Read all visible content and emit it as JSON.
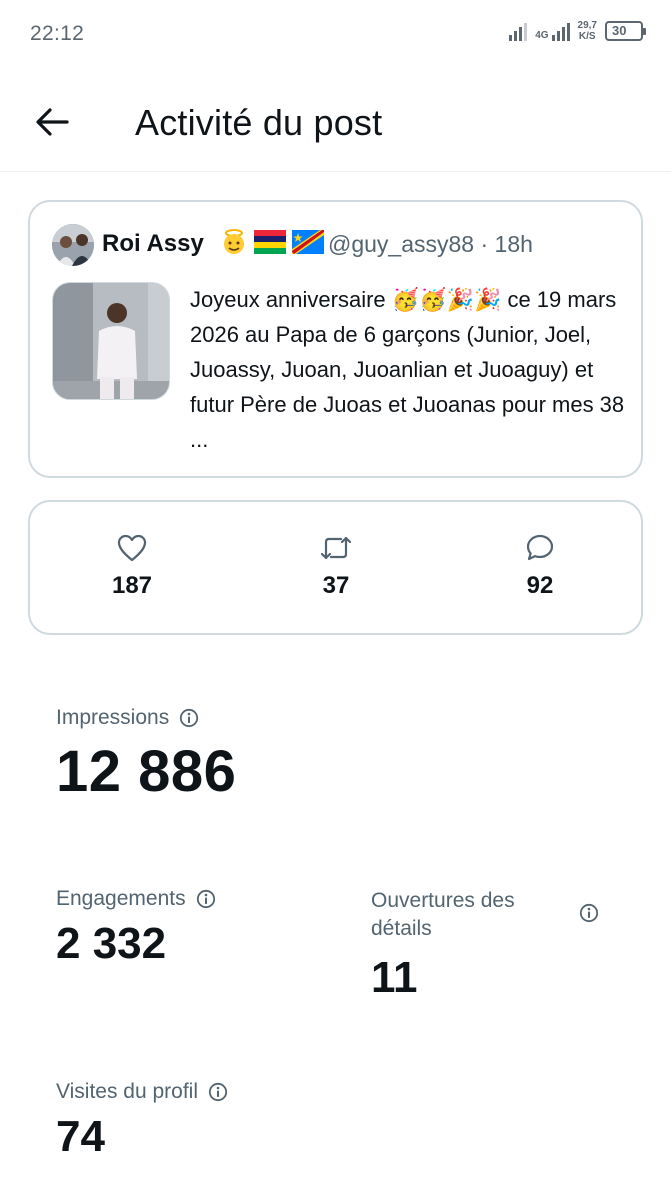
{
  "status_bar": {
    "time": "22:12",
    "network": "4G",
    "speed_value": "29,7",
    "speed_unit": "K/S",
    "battery": "30"
  },
  "header": {
    "back_icon": "arrow-left-icon",
    "title": "Activité du post"
  },
  "post": {
    "author": "Roi Assy",
    "badges": [
      "angel-emoji",
      "mauritius-flag",
      "drc-flag"
    ],
    "handle_time": "@guy_assy88 · 18h",
    "text": "Joyeux anniversaire 🥳🥳🎉🎉 ce 19 mars 2026 au Papa de 6 garçons (Junior, Joel, Juoassy, Juoan, Juoanlian et Juoaguy) et futur Père de Juoas et Juoanas pour mes 38 ..."
  },
  "engagement": {
    "likes": "187",
    "reposts": "37",
    "replies": "92",
    "icons": [
      "heart-icon",
      "repost-icon",
      "reply-icon"
    ]
  },
  "metrics": {
    "impressions": {
      "label": "Impressions",
      "value": "12 886"
    },
    "engagements": {
      "label": "Engagements",
      "value": "2 332"
    },
    "detail_opens": {
      "label": "Ouvertures des détails",
      "value": "11"
    },
    "profile_visits": {
      "label": "Visites du profil",
      "value": "74"
    }
  },
  "colors": {
    "text_primary": "#0f1419",
    "text_secondary": "#536471",
    "border": "#cfd9de"
  }
}
